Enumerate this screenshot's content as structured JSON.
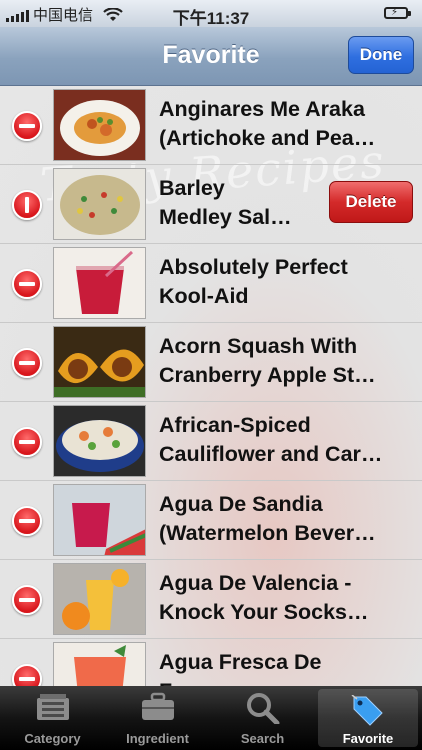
{
  "status_bar": {
    "carrier": "中国电信",
    "time": "下午11:37"
  },
  "nav": {
    "title": "Favorite",
    "done_label": "Done"
  },
  "list": {
    "items": [
      {
        "title": "Anginares Me Araka\n(Artichoke and Pea…",
        "thumb": "shrimp-dish"
      },
      {
        "title": "Barley\nMedley Sal…",
        "thumb": "grain-salad",
        "delete_label": "Delete"
      },
      {
        "title": "Absolutely Perfect\nKool-Aid",
        "thumb": "red-drink"
      },
      {
        "title": "Acorn Squash With\nCranberry Apple St…",
        "thumb": "squash"
      },
      {
        "title": "African-Spiced\nCauliflower and Car…",
        "thumb": "salad-bowl"
      },
      {
        "title": "Agua De Sandia\n(Watermelon Bever…",
        "thumb": "watermelon-drink"
      },
      {
        "title": "Agua De Valencia -\nKnock Your Socks…",
        "thumb": "orange-drink"
      },
      {
        "title": "Agua Fresca De\nFresa",
        "thumb": "strawberry-drink"
      }
    ]
  },
  "tabs": [
    {
      "label": "Category",
      "icon": "category-icon"
    },
    {
      "label": "Ingredient",
      "icon": "briefcase-icon"
    },
    {
      "label": "Search",
      "icon": "search-icon"
    },
    {
      "label": "Favorite",
      "icon": "tag-icon",
      "selected": true
    }
  ],
  "colors": {
    "nav_bar": "#8aa2bd",
    "done_button": "#2f6fe0",
    "delete_button": "#d42a2a",
    "delete_control": "#d8161c",
    "tab_bar": "#141414"
  }
}
